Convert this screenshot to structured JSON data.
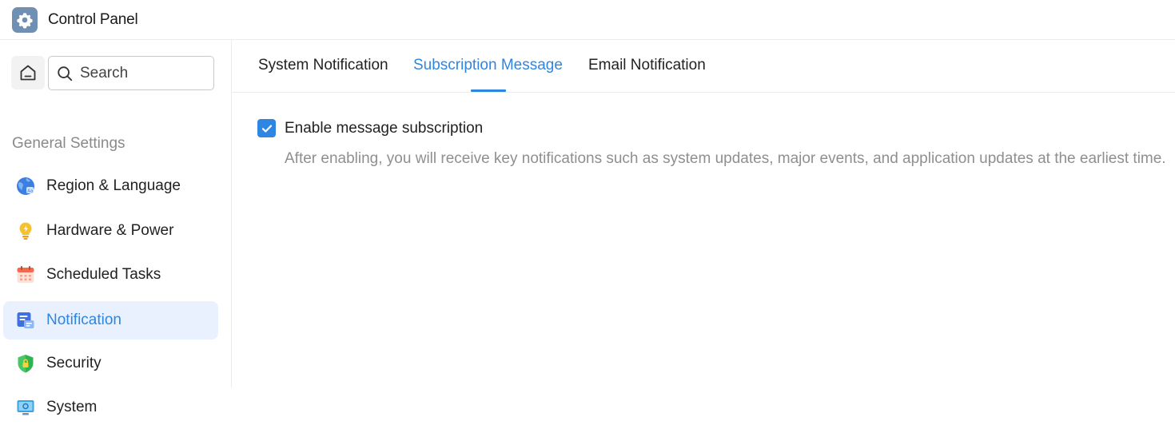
{
  "app": {
    "title": "Control Panel",
    "icon": "gear-icon"
  },
  "sidebar": {
    "search_placeholder": "Search",
    "section_label": "General Settings",
    "items": [
      {
        "label": "Region & Language",
        "icon": "globe-icon",
        "active": false
      },
      {
        "label": "Hardware & Power",
        "icon": "lightbulb-icon",
        "active": false
      },
      {
        "label": "Scheduled Tasks",
        "icon": "calendar-icon",
        "active": false
      },
      {
        "label": "Notification",
        "icon": "notification-icon",
        "active": true
      },
      {
        "label": "Security",
        "icon": "shield-icon",
        "active": false
      },
      {
        "label": "System",
        "icon": "monitor-icon",
        "active": false
      }
    ]
  },
  "tabs": [
    {
      "label": "System Notification",
      "active": false
    },
    {
      "label": "Subscription Message",
      "active": true
    },
    {
      "label": "Email Notification",
      "active": false
    }
  ],
  "subscription": {
    "checkbox_label": "Enable message subscription",
    "checked": true,
    "description": "After enabling, you will receive key notifications such as system updates, major events, and application updates at the earliest time."
  },
  "colors": {
    "accent": "#2f86e0",
    "active_bg": "#e8f1fd",
    "muted_text": "#8f8f8f"
  }
}
